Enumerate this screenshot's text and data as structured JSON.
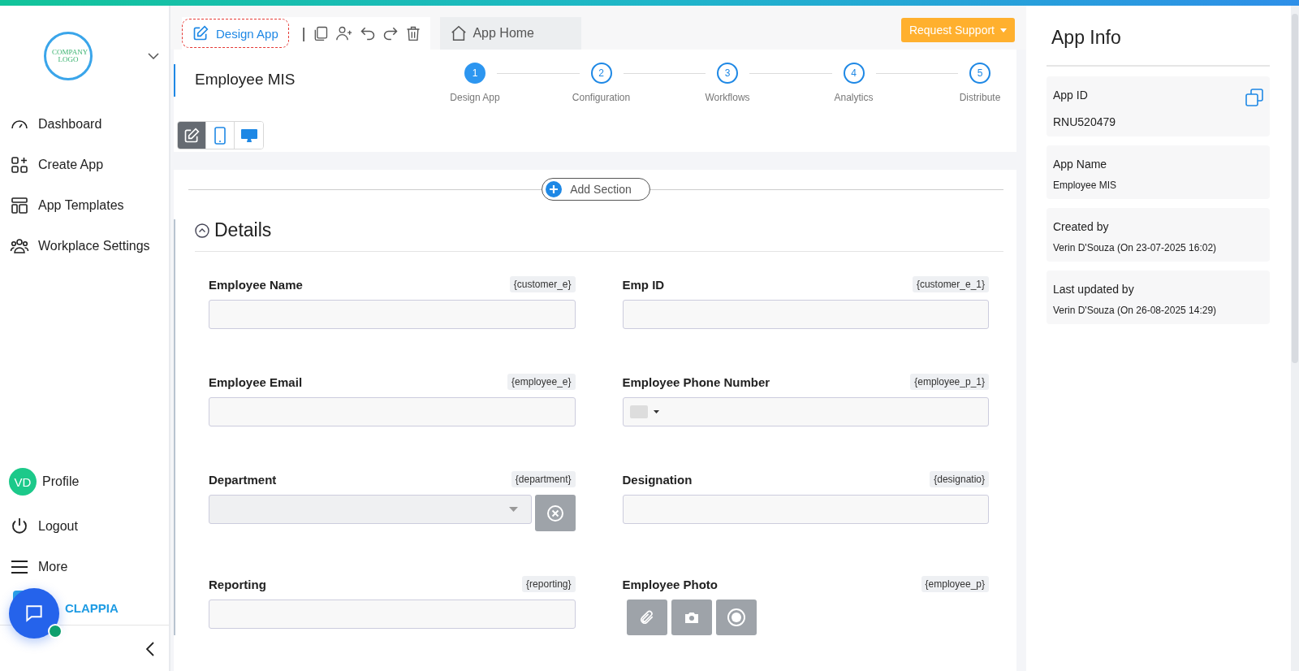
{
  "sidebar": {
    "logo_text": "COMPANY LOGO",
    "nav": [
      {
        "kind": "dashboard",
        "label": "Dashboard"
      },
      {
        "kind": "create",
        "label": "Create App"
      },
      {
        "kind": "templates",
        "label": "App Templates"
      },
      {
        "kind": "settings",
        "label": "Workplace Settings"
      }
    ],
    "bottom": [
      {
        "kind": "profile",
        "label": "Profile",
        "initials": "VD"
      },
      {
        "kind": "logout",
        "label": "Logout"
      },
      {
        "kind": "more",
        "label": "More"
      }
    ],
    "brand": "CLAPPIA"
  },
  "toolbar": {
    "design_tab": "Design App",
    "separator": "|",
    "home_tab": "App Home",
    "support_button": "Request Support"
  },
  "app_title": "Employee MIS",
  "steps": [
    {
      "number": "1",
      "label": "Design App",
      "selected": true
    },
    {
      "number": "2",
      "label": "Configuration",
      "selected": false
    },
    {
      "number": "3",
      "label": "Workflows",
      "selected": false
    },
    {
      "number": "4",
      "label": "Analytics",
      "selected": false
    },
    {
      "number": "5",
      "label": "Distribute",
      "selected": false
    }
  ],
  "view_modes": [
    {
      "kind": "edit",
      "selected": true
    },
    {
      "kind": "mobile",
      "selected": false
    },
    {
      "kind": "desktop",
      "selected": false
    }
  ],
  "add_section": "Add Section",
  "section": {
    "title": "Details",
    "expanded": true,
    "fields": [
      {
        "kind": "text",
        "label": "Employee Name",
        "variable": "{customer_e}"
      },
      {
        "kind": "text",
        "label": "Emp ID",
        "variable": "{customer_e_1}"
      },
      {
        "kind": "text",
        "label": "Employee Email",
        "variable": "{employee_e}"
      },
      {
        "kind": "phone",
        "label": "Employee Phone Number",
        "variable": "{employee_p_1}"
      },
      {
        "kind": "dropdown",
        "label": "Department",
        "variable": "{department}"
      },
      {
        "kind": "text",
        "label": "Designation",
        "variable": "{designatio}"
      },
      {
        "kind": "text",
        "label": "Reporting",
        "variable": "{reporting}"
      },
      {
        "kind": "files",
        "label": "Employee Photo",
        "variable": "{employee_p}"
      }
    ]
  },
  "app_info": {
    "title": "App Info",
    "cards": [
      {
        "label": "App ID",
        "value": "RNU520479",
        "copyable": true
      },
      {
        "label": "App Name",
        "value": "Employee MIS",
        "copyable": false
      },
      {
        "label": "Created by",
        "value": "Verin D'Souza (On 23-07-2025 16:02)",
        "copyable": false
      },
      {
        "label": "Last updated by",
        "value": "Verin D'Souza (On 26-08-2025 14:29)",
        "copyable": false
      }
    ]
  }
}
